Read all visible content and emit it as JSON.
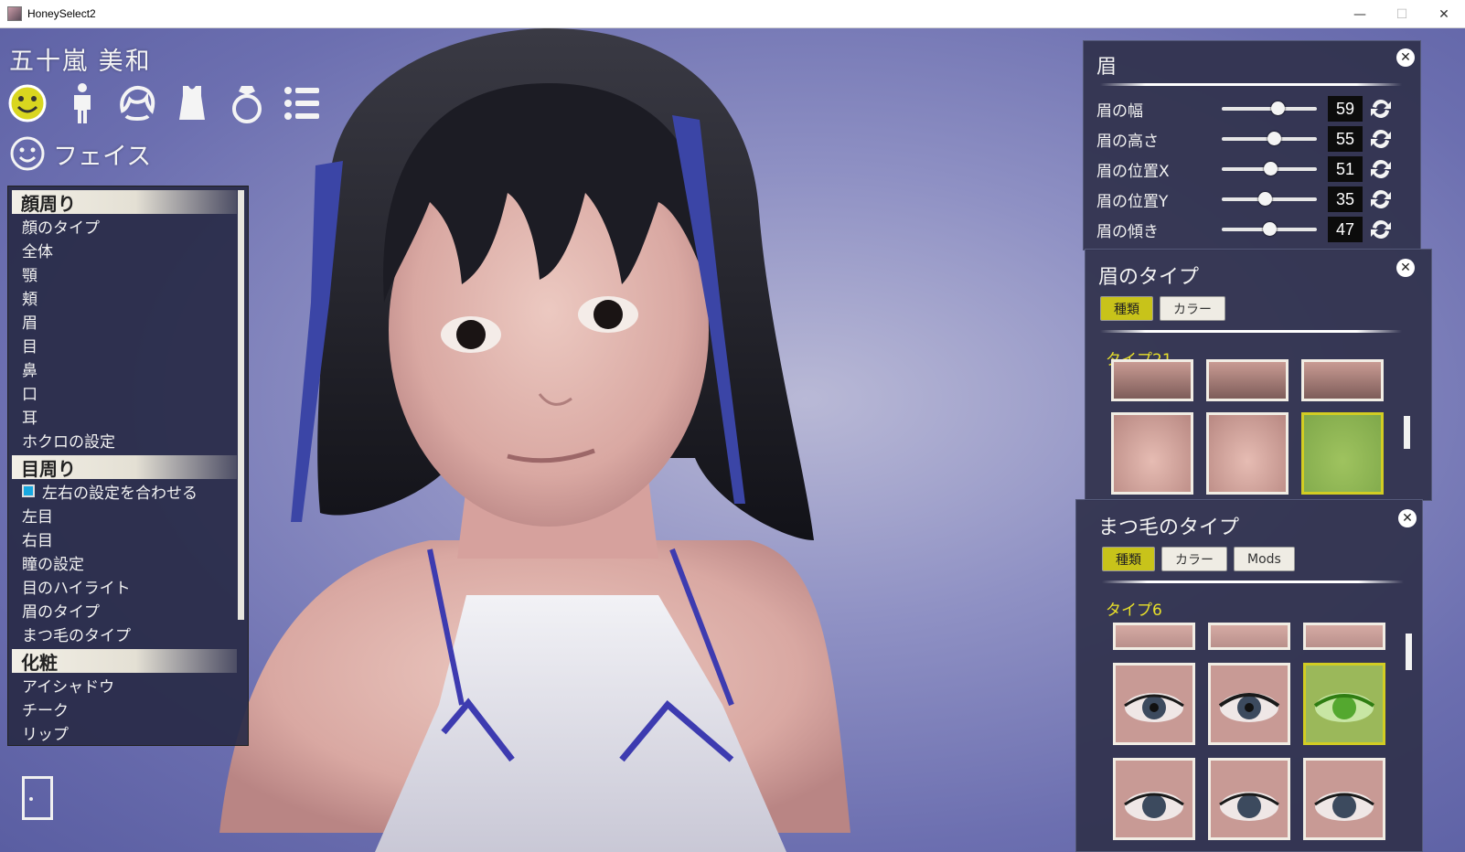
{
  "window": {
    "title": "HoneySelect2"
  },
  "character": {
    "name": "五十嵐 美和"
  },
  "tabs": [
    {
      "icon": "smiley-face-icon"
    },
    {
      "icon": "body-figure-icon"
    },
    {
      "icon": "hair-icon"
    },
    {
      "icon": "clothing-icon"
    },
    {
      "icon": "accessory-ring-icon"
    },
    {
      "icon": "list-menu-icon"
    }
  ],
  "section": {
    "label": "フェイス"
  },
  "menu": {
    "groups": [
      {
        "header": "顔周り",
        "items": [
          "顔のタイプ",
          "全体",
          "顎",
          "頬",
          "眉",
          "目",
          "鼻",
          "口",
          "耳",
          "ホクロの設定"
        ]
      },
      {
        "header": "目周り",
        "check_label": "左右の設定を合わせる",
        "items": [
          "左目",
          "右目",
          "瞳の設定",
          "目のハイライト",
          "眉のタイプ",
          "まつ毛のタイプ"
        ]
      },
      {
        "header": "化粧",
        "items": [
          "アイシャドウ",
          "チーク",
          "リップ"
        ]
      }
    ]
  },
  "eyebrow_panel": {
    "title": "眉",
    "sliders": [
      {
        "label": "眉の幅",
        "value": "59",
        "fraction": 0.59
      },
      {
        "label": "眉の高さ",
        "value": "55",
        "fraction": 0.55
      },
      {
        "label": "眉の位置X",
        "value": "51",
        "fraction": 0.51
      },
      {
        "label": "眉の位置Y",
        "value": "35",
        "fraction": 0.45
      },
      {
        "label": "眉の傾き",
        "value": "47",
        "fraction": 0.5
      }
    ]
  },
  "brow_type_panel": {
    "title": "眉のタイプ",
    "buttons": [
      "種類",
      "カラー"
    ],
    "selected_type": "タイプ21"
  },
  "lash_type_panel": {
    "title": "まつ毛のタイプ",
    "buttons": [
      "種類",
      "カラー",
      "Mods"
    ],
    "selected_type": "タイプ6"
  },
  "colors": {
    "accent_yellow": "#c8c31a",
    "selected_type_text": "#e8e02a",
    "scene_bg": "#7b7fb8"
  }
}
